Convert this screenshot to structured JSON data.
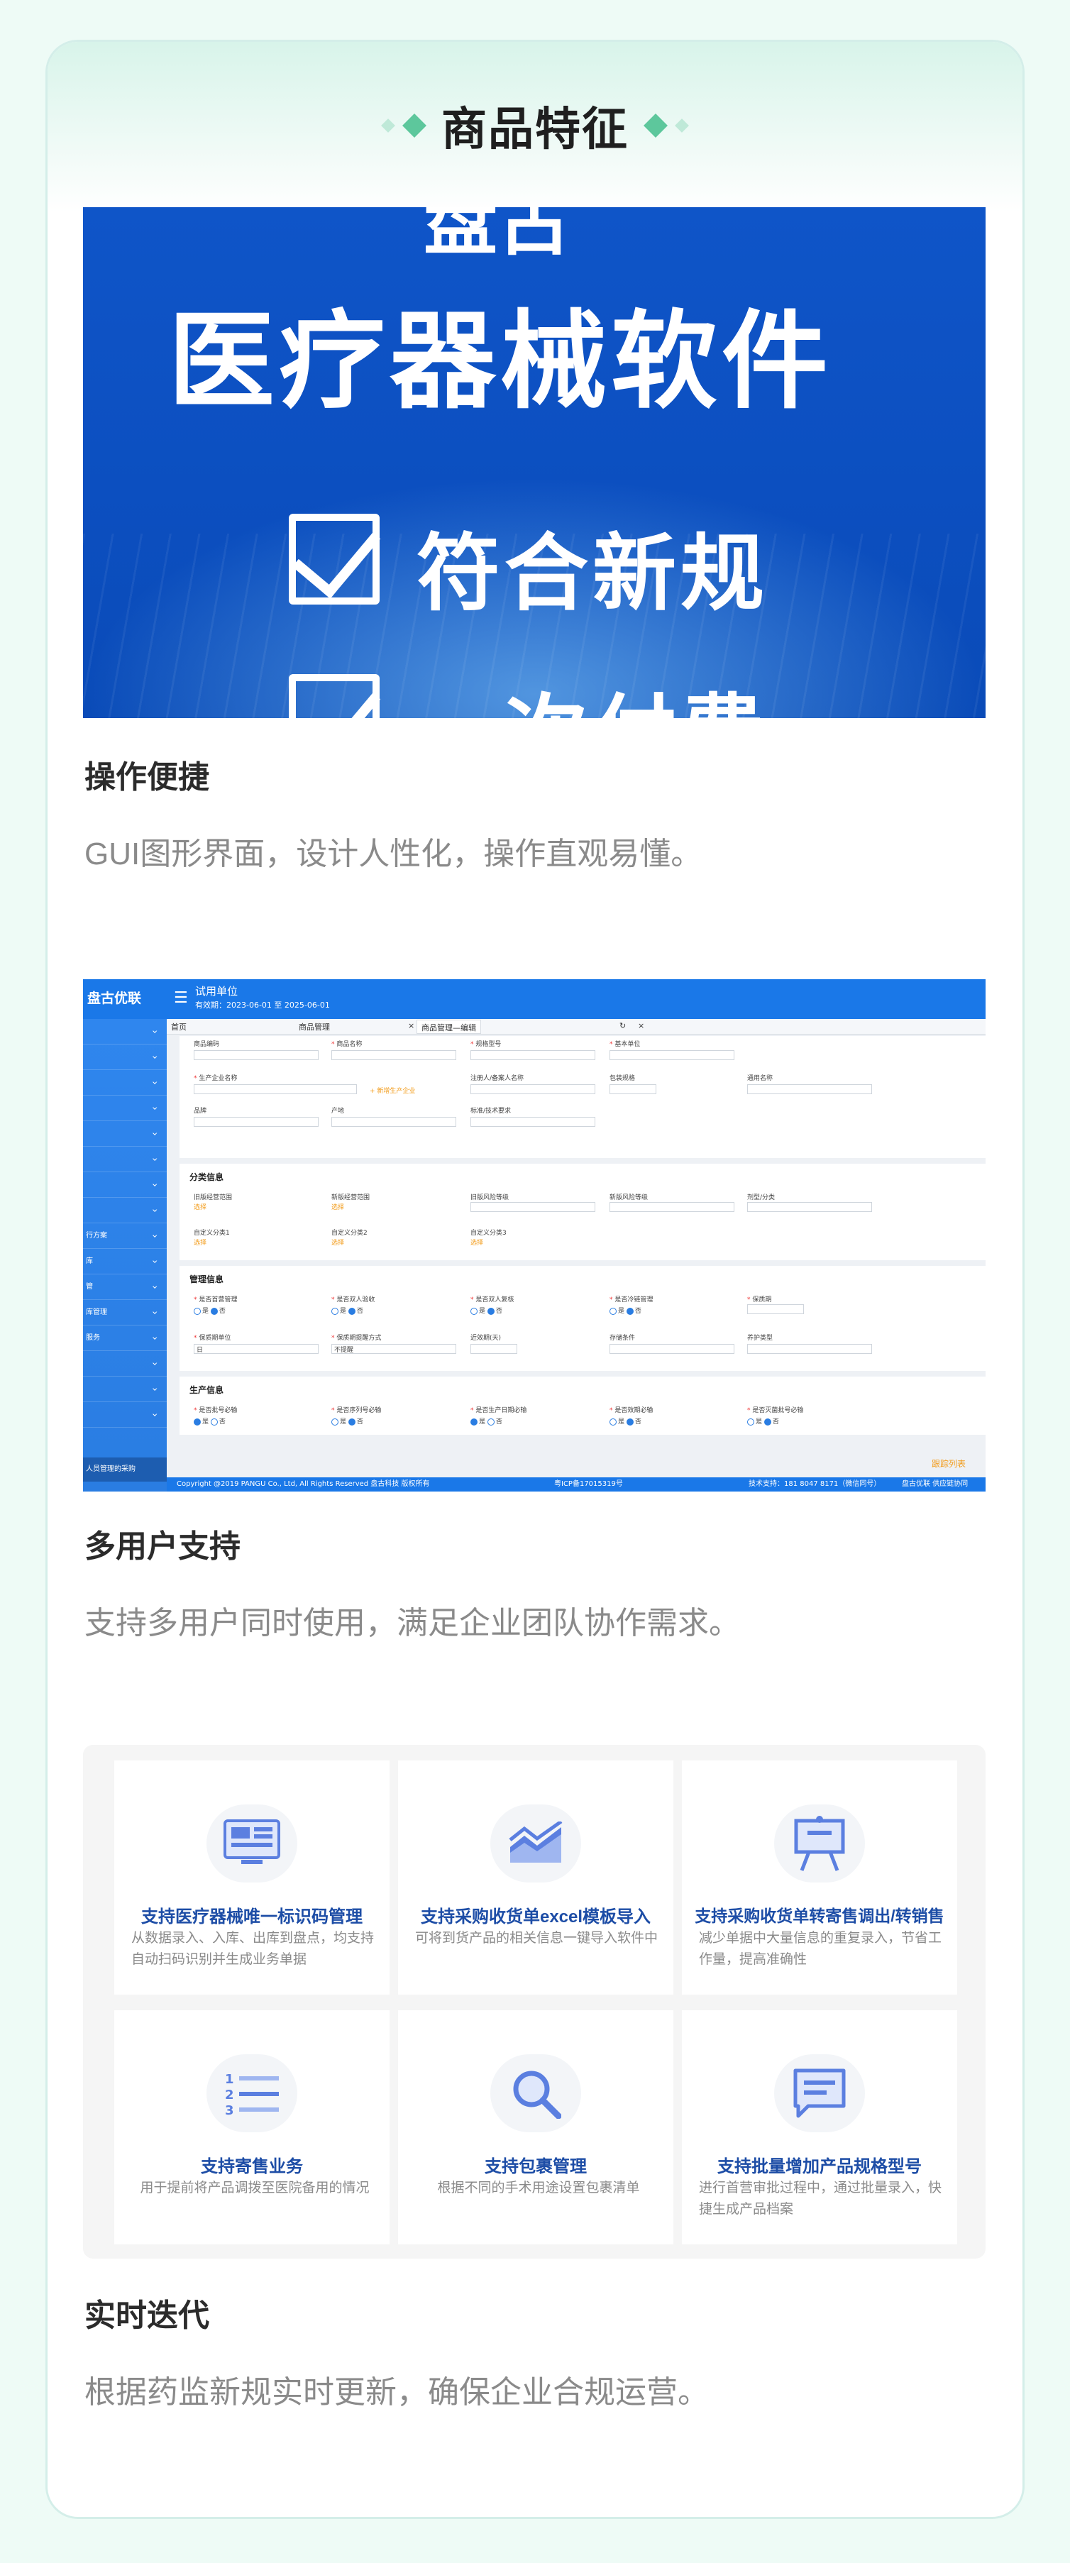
{
  "header": {
    "title": "商品特征"
  },
  "hero": {
    "line_top": "盘古",
    "line_main": "医疗器械软件",
    "line_check1": "符合新规",
    "line_check2": "一次付费"
  },
  "sections": [
    {
      "title": "操作便捷",
      "desc": "GUI图形界面，设计人性化，操作直观易懂。"
    },
    {
      "title": "多用户支持",
      "desc": "支持多用户同时使用，满足企业团队协作需求。"
    },
    {
      "title": "实时迭代",
      "desc": "根据药监新规实时更新，确保企业合规运营。"
    }
  ],
  "software": {
    "logo": "盘古优联",
    "unit": "试用单位",
    "date": "有效期：2023-06-01 至 2025-06-01",
    "tabs": [
      "首页",
      "商品管理",
      "商品管理—编辑"
    ],
    "panels": [
      "分类信息",
      "管理信息",
      "生产信息"
    ],
    "fields_basic": [
      "商品编码",
      "商品名称",
      "规格型号",
      "基本单位",
      "生产企业名称",
      "注册人/备案人名称",
      "包装规格",
      "通用名称",
      "品牌",
      "产地",
      "标准/技术要求"
    ],
    "add_company": "+ 新增生产企业",
    "fields_class": [
      "旧版经营范围",
      "新版经营范围",
      "旧版风险等级",
      "新版风险等级",
      "剂型/分类",
      "自定义分类1",
      "自定义分类2",
      "自定义分类3"
    ],
    "select_text": "选择",
    "fields_manage": [
      "是否首营管理",
      "是否双人验收",
      "是否双人复核",
      "是否冷链管理",
      "保质期",
      "保质期单位",
      "保质期提醒方式",
      "近效期(天)",
      "存储条件",
      "养护类型"
    ],
    "fields_prod": [
      "是否批号必输",
      "是否序列号必输",
      "是否生产日期必输",
      "是否效期必输",
      "是否灭菌批号必输"
    ],
    "yes": "是",
    "no": "否",
    "day": "日",
    "no_remind": "不提醒",
    "sidebar_foot": "人员管理的采购",
    "sidebar_labels": [
      "",
      "",
      "",
      "",
      "",
      "",
      "",
      "",
      "",
      "",
      "行方案",
      "库",
      "管",
      "库管理",
      "服务",
      "",
      "",
      "",
      "",
      "",
      ""
    ],
    "footer_copy": "Copyright @2019 PANGU Co., Ltd, All Rights Reserved 盘古科技 版权所有",
    "footer_icp": "粤ICP备17015319号",
    "footer_tel": "技术支持：181 8047 8171（微信同号）",
    "footer_brand": "盘古优联 供应链协同",
    "save_btn": "跟踪列表"
  },
  "features": [
    {
      "icon": "dashboard-icon",
      "title": "支持医疗器械唯一标识码管理",
      "desc": "从数据录入、入库、出库到盘点，均支持自动扫码识别并生成业务单据"
    },
    {
      "icon": "chart-icon",
      "title": "支持采购收货单excel模板导入",
      "desc": "可将到货产品的相关信息一键导入软件中"
    },
    {
      "icon": "presentation-icon",
      "title": "支持采购收货单转寄售调出/转销售",
      "desc": "减少单据中大量信息的重复录入，节省工作量，提高准确性"
    },
    {
      "icon": "numbered-list-icon",
      "title": "支持寄售业务",
      "desc": "用于提前将产品调拨至医院备用的情况"
    },
    {
      "icon": "search-icon",
      "title": "支持包裹管理",
      "desc": "根据不同的手术用途设置包裹清单"
    },
    {
      "icon": "message-icon",
      "title": "支持批量增加产品规格型号",
      "desc": "进行首营审批过程中，通过批量录入，快捷生成产品档案"
    }
  ],
  "colors": {
    "accent": "#5dc79c",
    "feature_title": "#1d4da6",
    "brand_blue": "#1a78e8"
  }
}
